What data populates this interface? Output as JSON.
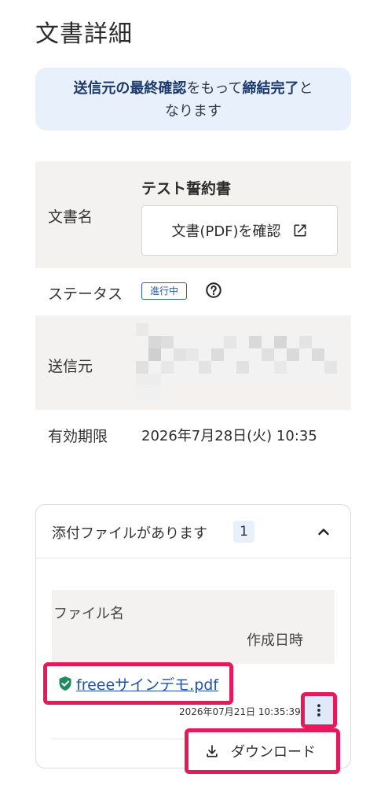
{
  "page": {
    "title": "文書詳細"
  },
  "notice": {
    "part1_bold": "送信元の最終確認",
    "part2": "をもって",
    "part3_bold": "締結完了",
    "part4": "と",
    "part5": "なります"
  },
  "doc": {
    "name_label": "文書名",
    "title": "テスト誓約書",
    "pdf_button_label": "文書(PDF)を確認",
    "status_label": "ステータス",
    "status_value": "進行中",
    "sender_label": "送信元",
    "expiry_label": "有効期限",
    "expiry_value": "2026年7月28日(火) 10:35"
  },
  "attachments": {
    "header_title": "添付ファイルがあります",
    "count": "1",
    "col_filename": "ファイル名",
    "col_created": "作成日時",
    "file_name": "freeeサインデモ.pdf",
    "file_created": "2026年07月21日 10:35:39",
    "download_label": "ダウンロード"
  },
  "colors": {
    "accent_blue": "#1d52b5",
    "highlight": "#e8195a",
    "notice_bg": "#e8f0fb",
    "shield_green": "#1f8a5b"
  },
  "icons": [
    "external-link-icon",
    "help-circle-icon",
    "chevron-up-icon",
    "shield-check-icon",
    "more-vertical-icon",
    "download-icon"
  ]
}
